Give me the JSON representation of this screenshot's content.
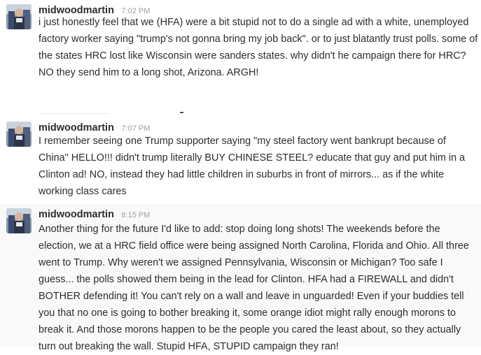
{
  "messages": [
    {
      "username": "midwoodmartin",
      "time": "7:02 PM",
      "text": "i just honestly feel that we (HFA) were a bit stupid not to do a single ad with a white, unemployed factory worker saying \"trump's not gonna bring my job back\". or to just blatantly trust polls.  some of the states HRC lost like Wisconsin were sanders states. why didn't he campaign there for HRC? NO they send him to a long shot, Arizona. ARGH!"
    },
    {
      "username": "midwoodmartin",
      "time": "7:07 PM",
      "text": "I remember seeing one Trump supporter saying \"my steel factory went bankrupt because of China\" HELLO!!! didn't trump literally BUY CHINESE STEEL? educate that guy and put him in a Clinton ad! NO, instead they had little children in suburbs in front of mirrors... as if the white working class cares"
    },
    {
      "username": "midwoodmartin",
      "time": "8:15 PM",
      "text": "Another thing for the future I'd like to add: stop doing long shots! The weekends before the election, we at a HRC field office were being assigned North Carolina, Florida and Ohio. All three went to Trump. Why weren't we assigned Pennsylvania, Wisconsin or Michigan? Too safe I guess... the polls showed them being in the lead for Clinton. HFA had a FIREWALL and didn't BOTHER defending it! You can't rely on a wall and leave in unguarded! Even if your buddies tell you that no one is going to bother breaking it, some orange idiot might rally enough morons to break it. And those morons happen to be the people you cared the least about, so they actually turn out breaking the wall. Stupid HFA, STUPID campaign they ran!"
    }
  ]
}
